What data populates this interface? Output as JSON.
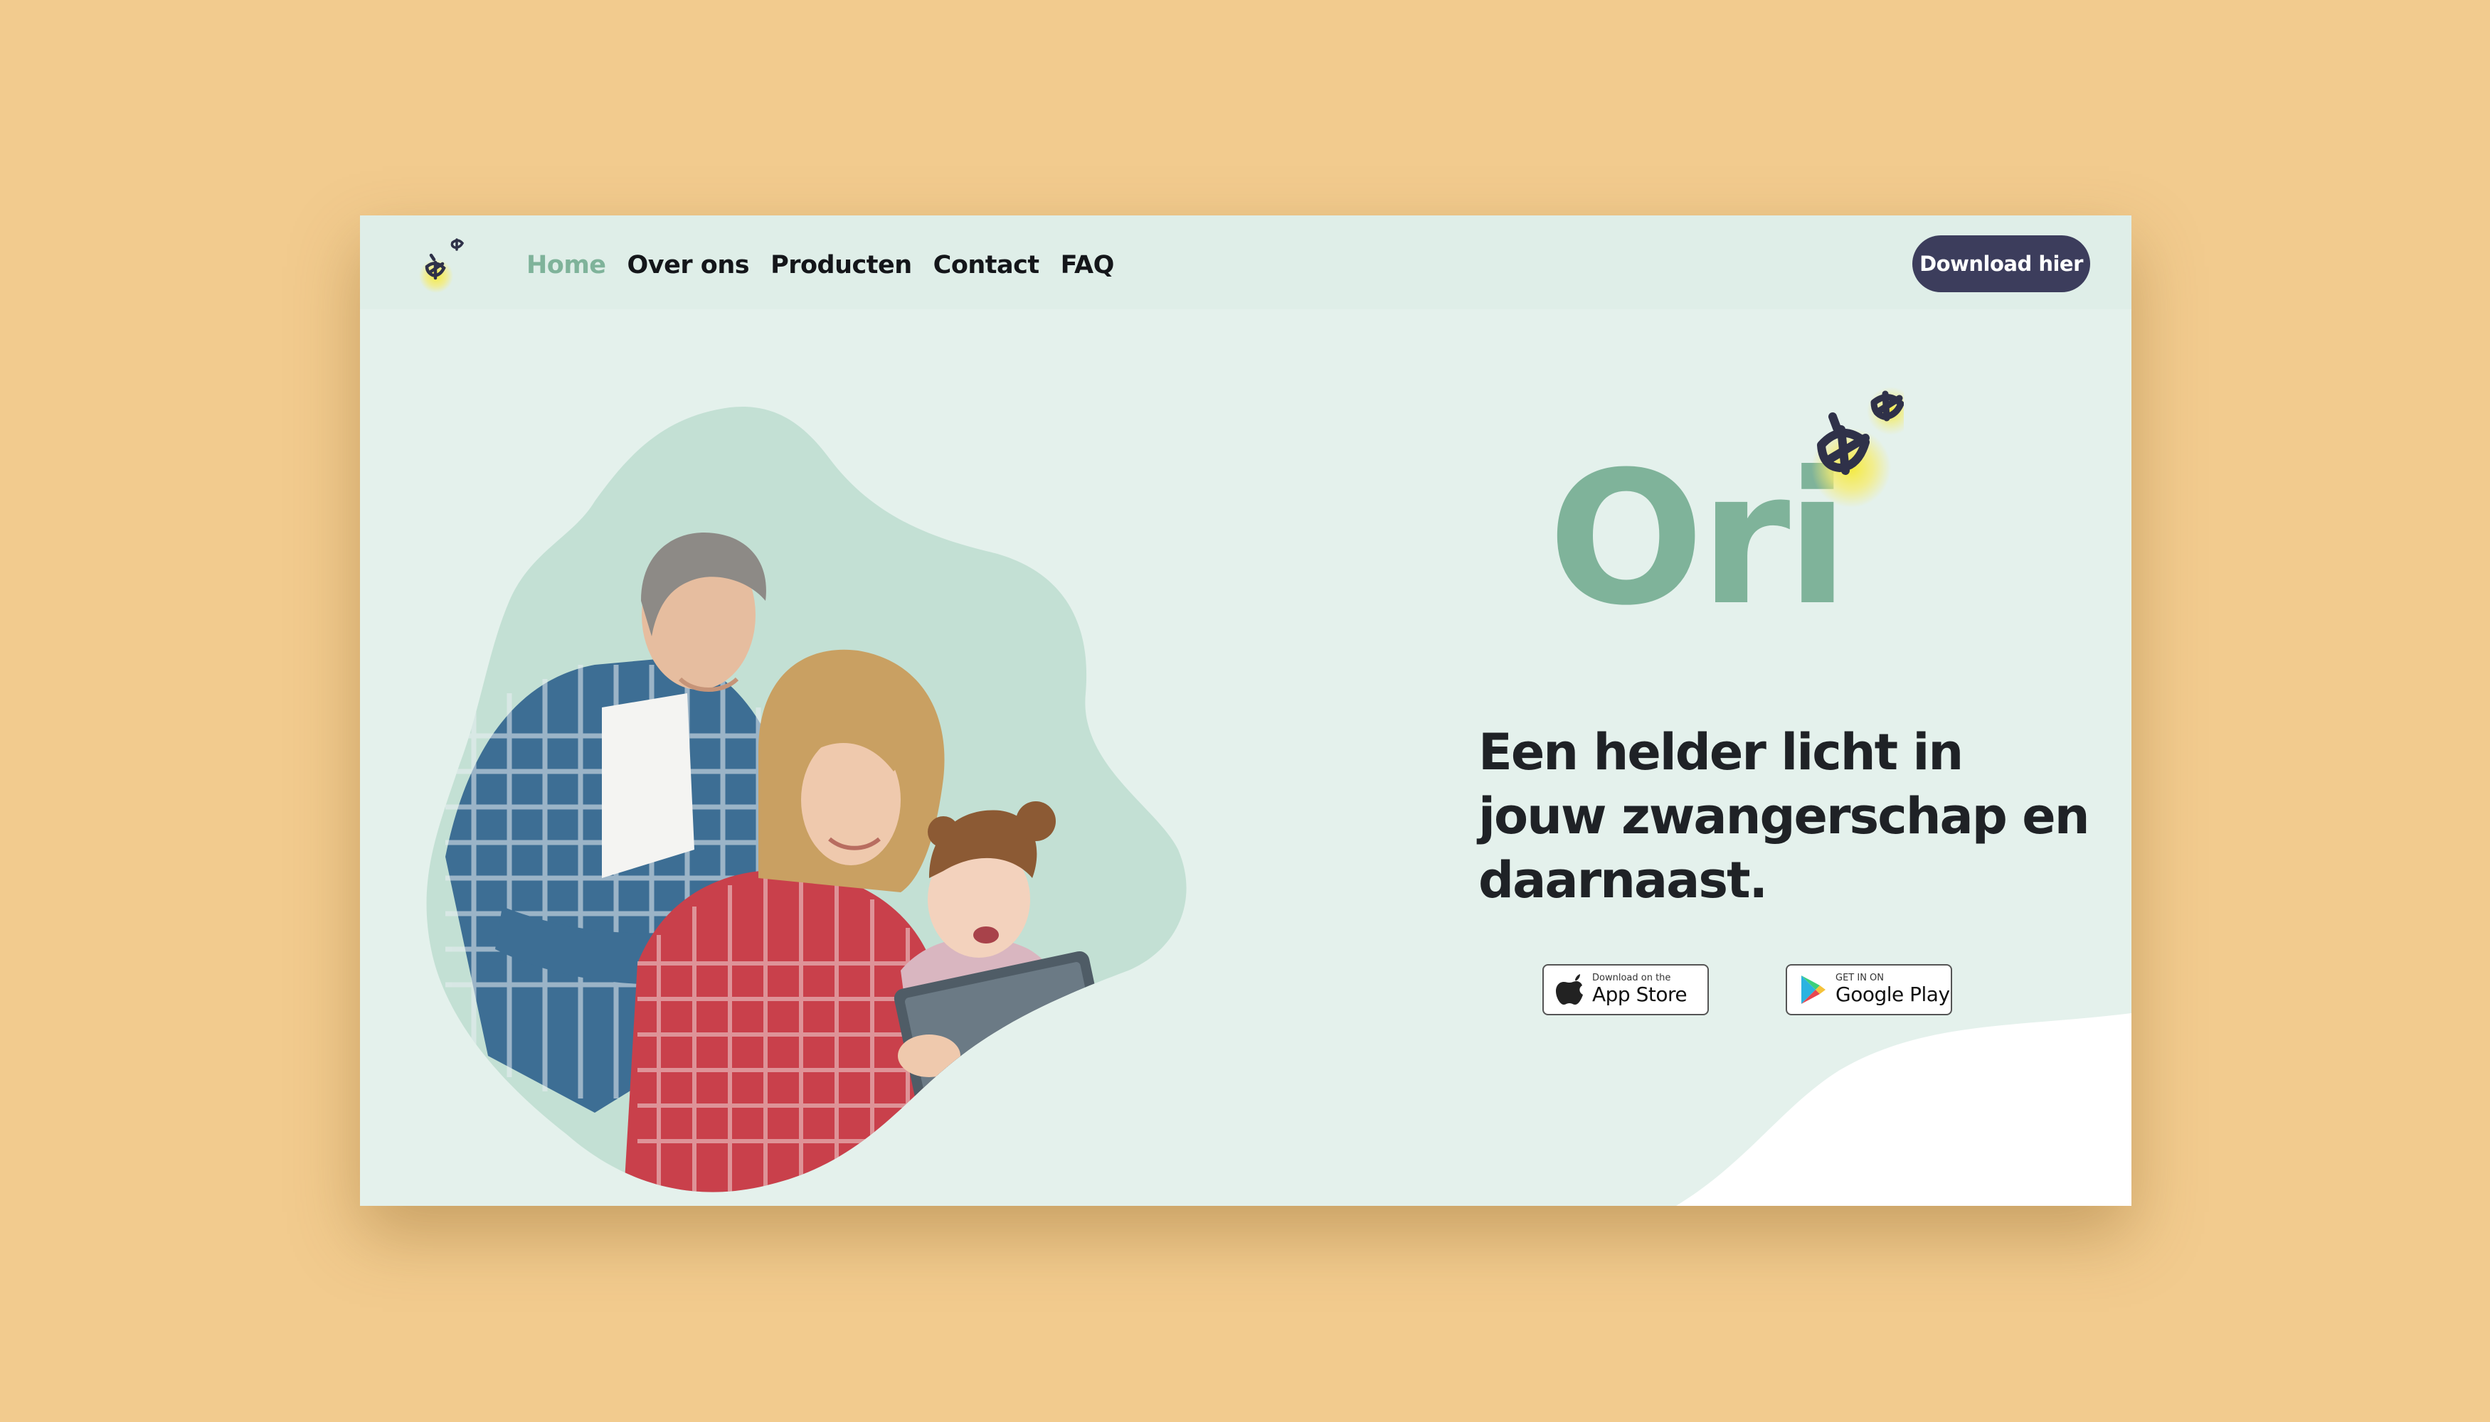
{
  "nav": {
    "links": [
      {
        "label": "Home",
        "active": true
      },
      {
        "label": "Over ons"
      },
      {
        "label": "Producten"
      },
      {
        "label": "Contact"
      },
      {
        "label": "FAQ"
      }
    ],
    "cta_label": "Download hier"
  },
  "hero": {
    "brand_name": "Ori",
    "tagline": "Een helder licht in jouw zwangerschap en daarnaast.",
    "photo_alt": "Family looking at a tablet",
    "badges": {
      "apple": {
        "small": "Download on the",
        "big": "App Store"
      },
      "google": {
        "small": "GET IN ON",
        "big": "Google Play"
      }
    }
  },
  "colors": {
    "page_background": "#f2cb8e",
    "site_background": "#e4f1ec",
    "blob": "#c3e0d4",
    "accent_green": "#7fb39a",
    "button_navy": "#3c3d5c",
    "firefly_glow": "#f2e64a"
  },
  "icons": [
    "firefly-logo-icon",
    "apple-icon",
    "google-play-icon"
  ]
}
